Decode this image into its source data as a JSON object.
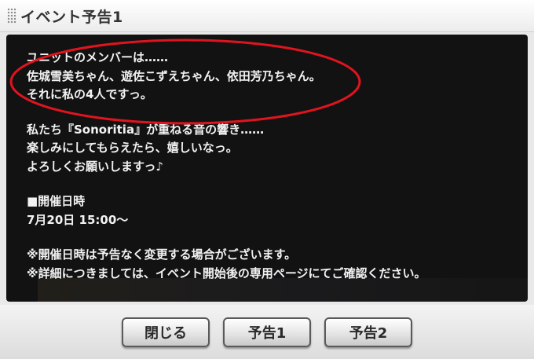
{
  "window": {
    "title": "イベント予告1"
  },
  "message": {
    "lines_group1": [
      "ユニットのメンバーは……",
      "佐城雪美ちゃん、遊佐こずえちゃん、依田芳乃ちゃん。",
      "それに私の4人ですっ。"
    ],
    "lines_group2": [
      "私たち『Sonoritia』が重ねる音の響き……",
      "楽しみにしてもらえたら、嬉しいなっ。",
      "よろしくお願いしますっ♪"
    ],
    "schedule_heading": "■開催日時",
    "schedule_value": "7月20日 15:00〜",
    "notes": [
      "※開催日時は予告なく変更する場合がございます。",
      "※詳細につきましては、イベント開始後の専用ページにてご確認ください。"
    ]
  },
  "annotation": {
    "ellipse_color": "#e0141e"
  },
  "buttons": {
    "close": "閉じる",
    "preview1": "予告1",
    "preview2": "予告2"
  }
}
